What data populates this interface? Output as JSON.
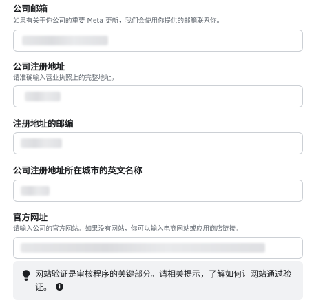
{
  "fields": [
    {
      "label": "公司邮箱",
      "hint": "如果有关于你公司的重要 Meta 更新，我们会使用你提供的邮箱联系你。",
      "value_redacted": true
    },
    {
      "label": "公司注册地址",
      "hint": "请准确输入营业执照上的完整地址。",
      "value_redacted": true
    },
    {
      "label": "注册地址的邮编",
      "value_redacted": true
    },
    {
      "label": "公司注册地址所在城市的英文名称",
      "value_redacted": true
    },
    {
      "label": "官方网址",
      "hint": "请输入公司的官方网站。如果没有网站，你可以输入电商网站或应用商店链接。",
      "value_redacted": true
    }
  ],
  "notice": {
    "icon": "lightbulb-icon",
    "text": "网站验证是审核程序的关键部分。请相关提示，了解如何让网站通过验证。",
    "info_icon": "info-icon"
  },
  "colors": {
    "label": "#1c1e21",
    "hint": "#60676f",
    "input_border": "#ccd0d5",
    "notice_bg": "#f1f2f4"
  }
}
